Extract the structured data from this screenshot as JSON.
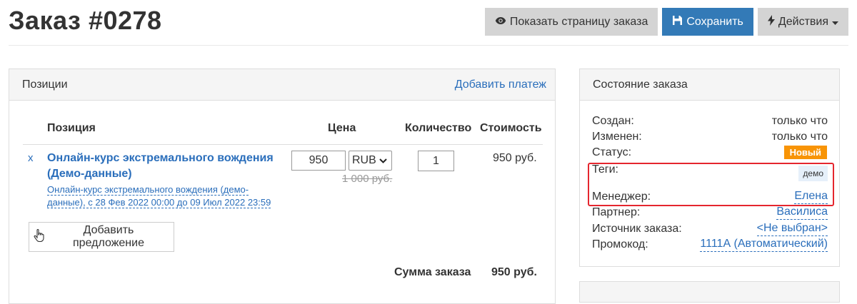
{
  "page": {
    "title": "Заказ #0278"
  },
  "toolbar": {
    "show_page_label": "Показать страницу заказа",
    "save_label": "Сохранить",
    "actions_label": "Действия"
  },
  "items_panel": {
    "title": "Позиции",
    "add_payment_link": "Добавить платеж",
    "columns": [
      "Позиция",
      "Цена",
      "Количество",
      "Стоимость"
    ],
    "rows": [
      {
        "remove": "x",
        "title": "Онлайн-курс экстремального вождения (Демо-данные)",
        "subtitle": "Онлайн-курс экстремального вождения (демо-данные), с 28 Фев 2022 00:00 до 09 Июл 2022 23:59",
        "price": "950",
        "currency": "RUB",
        "old_price": "1 000 руб.",
        "quantity": "1",
        "cost": "950 руб."
      }
    ],
    "add_offer_label": "Добавить предложение",
    "total_label": "Сумма заказа",
    "total_value": "950 руб."
  },
  "state_panel": {
    "title": "Состояние заказа",
    "created_label": "Создан:",
    "created_value": "только что",
    "modified_label": "Изменен:",
    "modified_value": "только что",
    "status_label": "Статус:",
    "status_value": "Новый",
    "tags_label": "Теги:",
    "tag_value": "демо",
    "manager_label": "Менеджер:",
    "manager_value": "Елена",
    "partner_label": "Партнер:",
    "partner_value": "Василиса",
    "source_label": "Источник заказа:",
    "source_value": "<Не выбран>",
    "promo_label": "Промокод:",
    "promo_value": "1111А (Автоматический)"
  },
  "colors": {
    "primary": "#337ab7",
    "link": "#2a6ebb",
    "status_new": "#f89406",
    "highlight": "#e5262e"
  },
  "icons": {
    "show_page": "eye-icon",
    "save": "floppy-disk-icon",
    "actions": "lightning-bolt-icon",
    "add_offer": "pointing-hand-icon"
  }
}
